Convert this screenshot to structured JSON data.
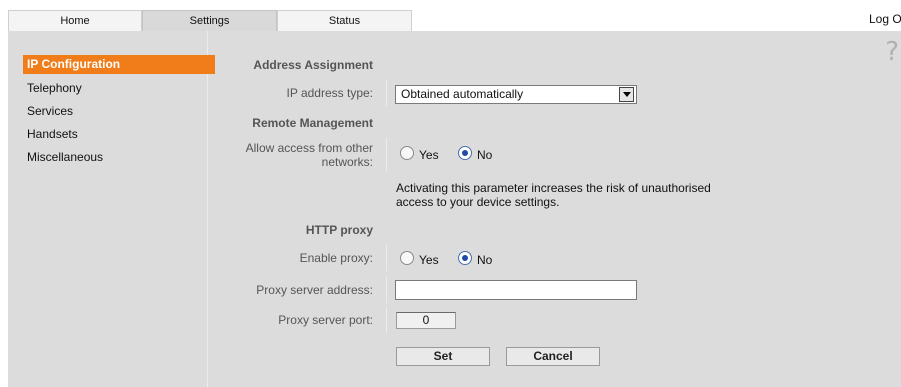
{
  "tabs": [
    {
      "label": "Home"
    },
    {
      "label": "Settings"
    },
    {
      "label": "Status"
    }
  ],
  "logoff": "Log Of",
  "help_icon": "?",
  "sidebar": {
    "items": [
      {
        "label": "IP Configuration",
        "active": true
      },
      {
        "label": "Telephony"
      },
      {
        "label": "Services"
      },
      {
        "label": "Handsets"
      },
      {
        "label": "Miscellaneous"
      }
    ]
  },
  "address": {
    "heading": "Address Assignment",
    "ip_type_label": "IP address type:",
    "ip_type_value": "Obtained automatically"
  },
  "remote": {
    "heading": "Remote Management",
    "allow_label_line1": "Allow access from other",
    "allow_label_line2": "networks:",
    "yes": "Yes",
    "no": "No",
    "selected": "No",
    "info_line1": "Activating this parameter increases the risk of unauthorised",
    "info_line2": "access to your device settings."
  },
  "proxy": {
    "heading": "HTTP proxy",
    "enable_label": "Enable proxy:",
    "yes": "Yes",
    "no": "No",
    "selected": "No",
    "server_label": "Proxy server address:",
    "server_value": "",
    "port_label": "Proxy server port:",
    "port_value": "0"
  },
  "actions": {
    "set": "Set",
    "cancel": "Cancel"
  },
  "colors": {
    "accent": "#f07d1a",
    "panel": "#dcdcdc"
  }
}
